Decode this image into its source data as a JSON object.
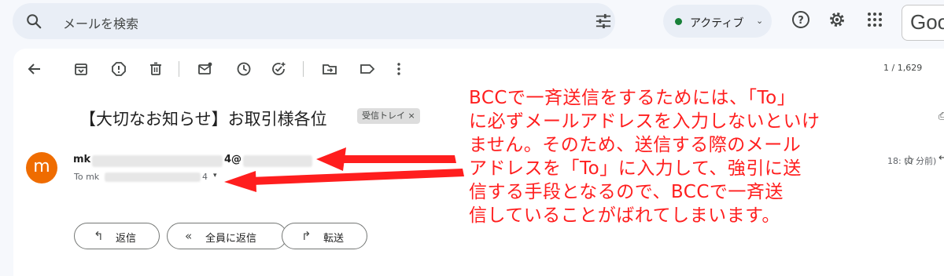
{
  "search": {
    "placeholder": "メールを検索",
    "icon": "search-icon",
    "tune_icon": "tune-icon"
  },
  "status": {
    "label": "アクティブ",
    "color": "#188038"
  },
  "header_icons": [
    "help-icon",
    "gear-icon",
    "apps-grid-icon"
  ],
  "brand": {
    "partial": "Goo"
  },
  "toolbar": {
    "counter": "1 / 1,629",
    "icons": [
      "back-arrow-icon",
      "archive-icon",
      "report-spam-icon",
      "delete-icon",
      "mark-unread-icon",
      "snooze-icon",
      "add-task-icon",
      "move-to-icon",
      "label-icon",
      "more-vert-icon"
    ]
  },
  "email": {
    "subject": "【大切なお知らせ】お取引様各位",
    "label_chip": "受信トレイ",
    "chip_close": "×",
    "avatar_letter": "m",
    "avatar_color": "#ef6c00",
    "from_prefix": "mk",
    "from_suffix": "4@",
    "to_prefix": "To mk",
    "to_suffix": "4",
    "to_caret": "▾",
    "time": "18:",
    "time_partial": "0 分前)"
  },
  "actions": [
    {
      "icon": "reply-icon",
      "glyph": "↰",
      "label": "返信"
    },
    {
      "icon": "reply-all-icon",
      "glyph": "«",
      "label": "全員に返信"
    },
    {
      "icon": "forward-icon",
      "glyph": "↱",
      "label": "転送"
    }
  ],
  "annotation": {
    "text": "BCCで一斉送信をするためには、「To」\nに必ずメールアドレスを入力しないといけ\nません。そのため、送信する際のメール\nアドレスを「To」に入力して、強引に送\n信する手段となるので、BCCで一斉送\n信していることがばれてしまいます。",
    "color": "#ff1e1e"
  }
}
